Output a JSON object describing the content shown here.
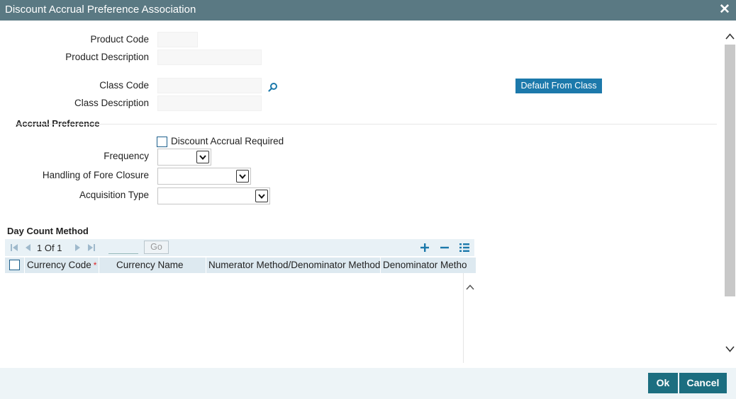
{
  "window": {
    "title": "Discount Accrual Preference Association"
  },
  "product": {
    "code_label": "Product Code",
    "code_value": "",
    "description_label": "Product Description",
    "description_value": ""
  },
  "class": {
    "code_label": "Class Code",
    "code_value": "",
    "description_label": "Class Description",
    "description_value": "",
    "default_button": "Default From Class"
  },
  "accrual": {
    "section_title": "Accrual Preference",
    "discount_required_label": "Discount Accrual Required",
    "discount_required_checked": false,
    "frequency_label": "Frequency",
    "frequency_value": "",
    "foreclosure_label": "Handling of Fore Closure",
    "foreclosure_value": "",
    "acquisition_label": "Acquisition Type",
    "acquisition_value": ""
  },
  "day_count": {
    "section_title": "Day Count Method",
    "page_current": "1",
    "page_of": "Of",
    "page_total": "1",
    "go_label": "Go",
    "columns": [
      "Currency Code",
      "Currency Name",
      "Numerator Method/Denominator Method",
      "Denominator Metho"
    ],
    "required_marker": "*",
    "rows": []
  },
  "footer": {
    "ok_label": "Ok",
    "cancel_label": "Cancel"
  },
  "colors": {
    "titlebar": "#5a7983",
    "primary_button": "#1c6e80",
    "accent_button": "#1c79ab",
    "grid_header": "#dde9f0",
    "footer_bg": "#edf4f7"
  },
  "icons": {
    "close": "close-icon",
    "search": "search-icon",
    "first_page": "first-page-icon",
    "prev_page": "prev-page-icon",
    "next_page": "next-page-icon",
    "last_page": "last-page-icon",
    "add_row": "add-row-icon",
    "delete_row": "delete-row-icon",
    "single_view": "single-view-icon"
  }
}
